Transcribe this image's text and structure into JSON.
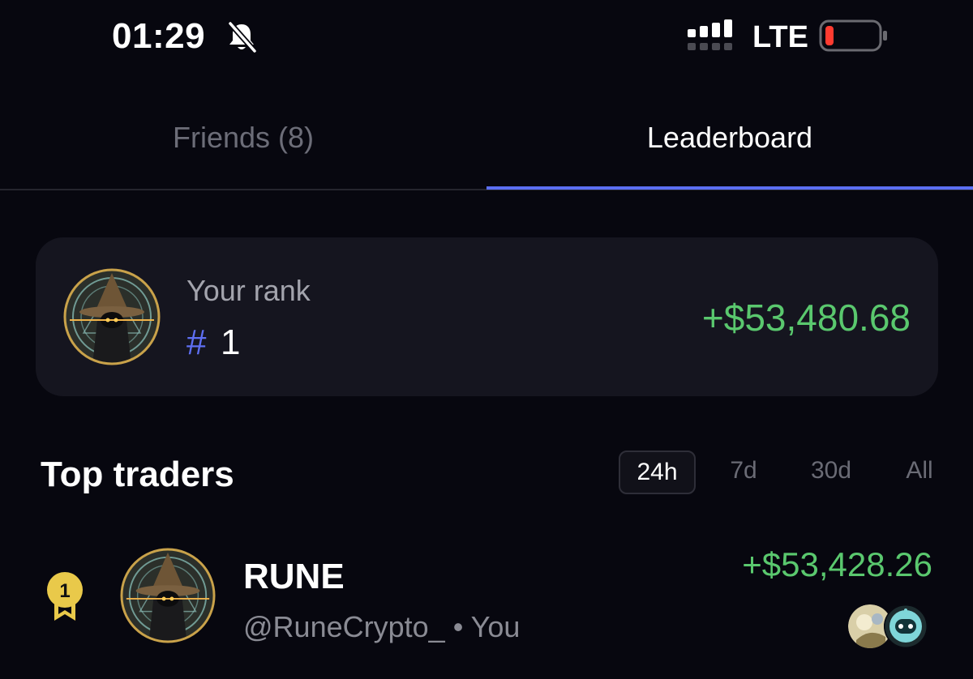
{
  "status_bar": {
    "time": "01:29",
    "network": "LTE",
    "icons": [
      "bell-muted-icon",
      "signal-icon",
      "battery-low-icon"
    ],
    "battery_color": "#ff3b30"
  },
  "tabs": [
    {
      "label": "Friends (8)",
      "active": false
    },
    {
      "label": "Leaderboard",
      "active": true
    }
  ],
  "colors": {
    "accent": "#5b6ef2",
    "positive": "#5ac86e",
    "card_bg": "#15151f",
    "page_bg": "#07070f"
  },
  "your_rank": {
    "label": "Your rank",
    "hash": "#",
    "rank": "1",
    "pnl": "+$53,480.68",
    "avatar": "wizard-avatar-icon"
  },
  "top_traders": {
    "title": "Top traders",
    "periods": [
      "24h",
      "7d",
      "30d",
      "All"
    ],
    "selected_period": "24h",
    "rows": [
      {
        "rank": "1",
        "name": "RUNE",
        "handle": "@RuneCrypto_",
        "you_label": "• You",
        "pnl": "+$53,428.26",
        "avatar": "wizard-avatar-icon",
        "badges": [
          "meme-token-icon",
          "robot-token-icon"
        ]
      }
    ]
  }
}
